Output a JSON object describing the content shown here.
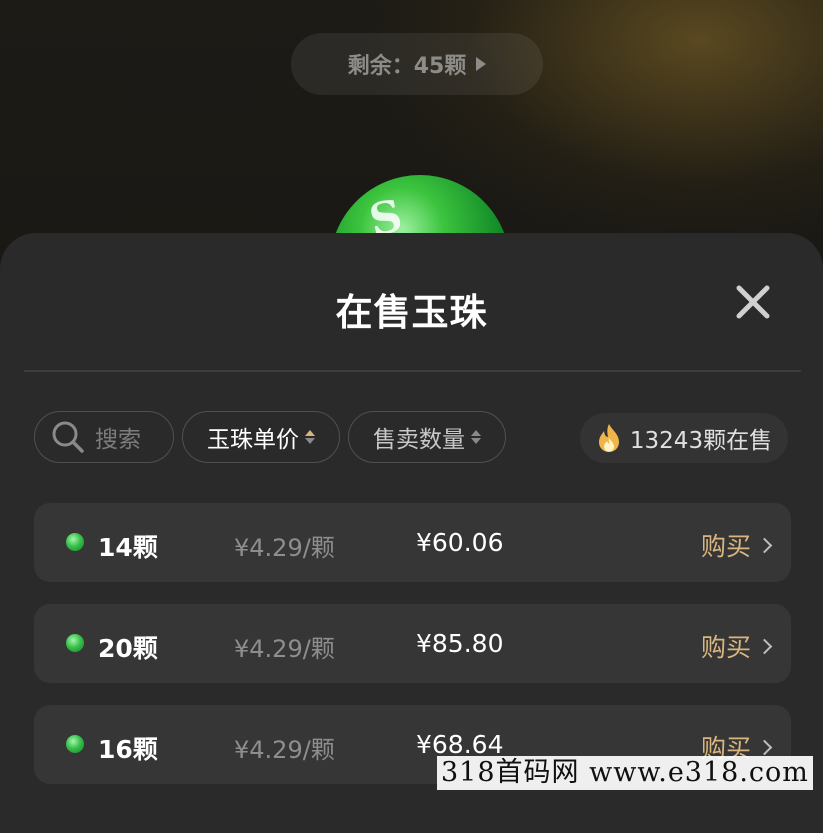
{
  "header": {
    "remaining_label": "剩余：45颗"
  },
  "sheet": {
    "title": "在售玉珠",
    "filters": {
      "search_placeholder": "搜索",
      "sort_price_label": "玉珠单价",
      "sort_quantity_label": "售卖数量",
      "on_sale_label": "13243颗在售"
    },
    "listings": [
      {
        "count": "14颗",
        "unit_price": "¥4.29/颗",
        "total": "¥60.06",
        "buy_label": "购买"
      },
      {
        "count": "20颗",
        "unit_price": "¥4.29/颗",
        "total": "¥85.80",
        "buy_label": "购买"
      },
      {
        "count": "16颗",
        "unit_price": "¥4.29/颗",
        "total": "¥68.64",
        "buy_label": "购买"
      }
    ]
  },
  "watermark": "318首码网  www.e318.com",
  "colors": {
    "accent_gold": "#d9b57f",
    "sheet_bg": "#2a2a2a",
    "row_bg": "#363636",
    "gem_green": "#39c14b"
  },
  "icons": [
    "play-arrow-icon",
    "close-icon",
    "search-icon",
    "sort-arrows-icon",
    "flame-icon",
    "gem-icon",
    "chevron-right-icon"
  ]
}
